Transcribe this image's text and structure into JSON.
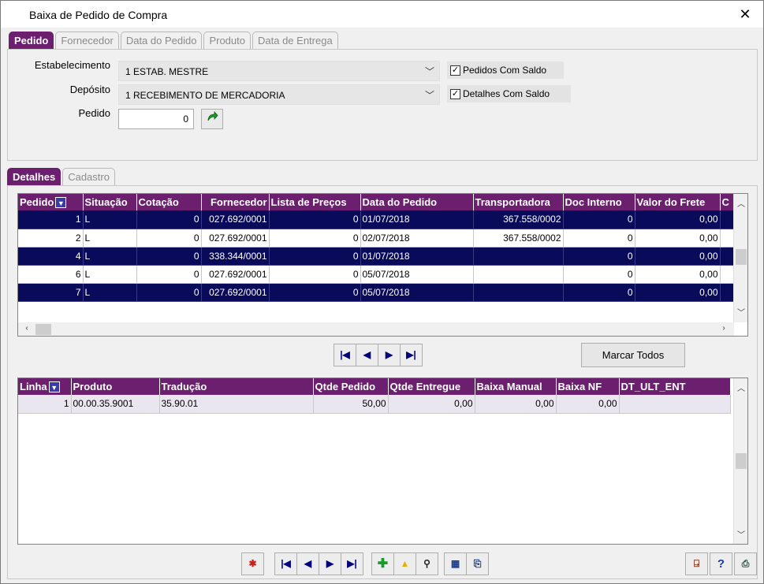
{
  "window": {
    "title": "Baixa de Pedido de Compra"
  },
  "top_tabs": [
    "Pedido",
    "Fornecedor",
    "Data do Pedido",
    "Produto",
    "Data de Entrega"
  ],
  "form": {
    "estabelecimento_label": "Estabelecimento",
    "estabelecimento_value": "1 ESTAB. MESTRE",
    "deposito_label": "Depósito",
    "deposito_value": "1 RECEBIMENTO DE MERCADORIA",
    "pedido_label": "Pedido",
    "pedido_value": "0",
    "chk_pedidos_saldo": "Pedidos Com Saldo",
    "chk_detalhes_saldo": "Detalhes Com Saldo"
  },
  "sub_tabs": [
    "Detalhes",
    "Cadastro"
  ],
  "orders": {
    "columns": [
      "Pedido",
      "Situação",
      "Cotação",
      "Fornecedor",
      "Lista de Preços",
      "Data do Pedido",
      "Transportadora",
      "Doc Interno",
      "Valor do Frete",
      "C"
    ],
    "rows": [
      [
        "1",
        "L",
        "0",
        "027.692/0001",
        "0",
        "01/07/2018",
        "367.558/0002",
        "0",
        "0,00",
        ""
      ],
      [
        "2",
        "L",
        "0",
        "027.692/0001",
        "0",
        "02/07/2018",
        "367.558/0002",
        "0",
        "0,00",
        ""
      ],
      [
        "4",
        "L",
        "0",
        "338.344/0001",
        "0",
        "01/07/2018",
        "",
        "0",
        "0,00",
        ""
      ],
      [
        "6",
        "L",
        "0",
        "027.692/0001",
        "0",
        "05/07/2018",
        "",
        "0",
        "0,00",
        ""
      ],
      [
        "7",
        "L",
        "0",
        "027.692/0001",
        "0",
        "05/07/2018",
        "",
        "0",
        "0,00",
        ""
      ]
    ]
  },
  "marcar_todos": "Marcar Todos",
  "lines": {
    "columns": [
      "Linha",
      "Produto",
      "Tradução",
      "Qtde Pedido",
      "Qtde Entregue",
      "Baixa Manual",
      "Baixa NF",
      "DT_ULT_ENT"
    ],
    "rows": [
      [
        "1",
        "00.00.35.9001",
        "35.90.01",
        "50,00",
        "0,00",
        "0,00",
        "0,00",
        ""
      ]
    ]
  },
  "icons": {
    "settings": "gears-icon",
    "first": "first-record-icon",
    "prev": "previous-record-icon",
    "next": "next-record-icon",
    "last": "last-record-icon",
    "add": "plus-icon",
    "edit": "edit-icon",
    "search": "magnifier-icon",
    "grid": "grid-view-icon",
    "export": "export-icon",
    "exit": "exit-door-icon",
    "help": "help-icon",
    "print": "print-icon"
  }
}
